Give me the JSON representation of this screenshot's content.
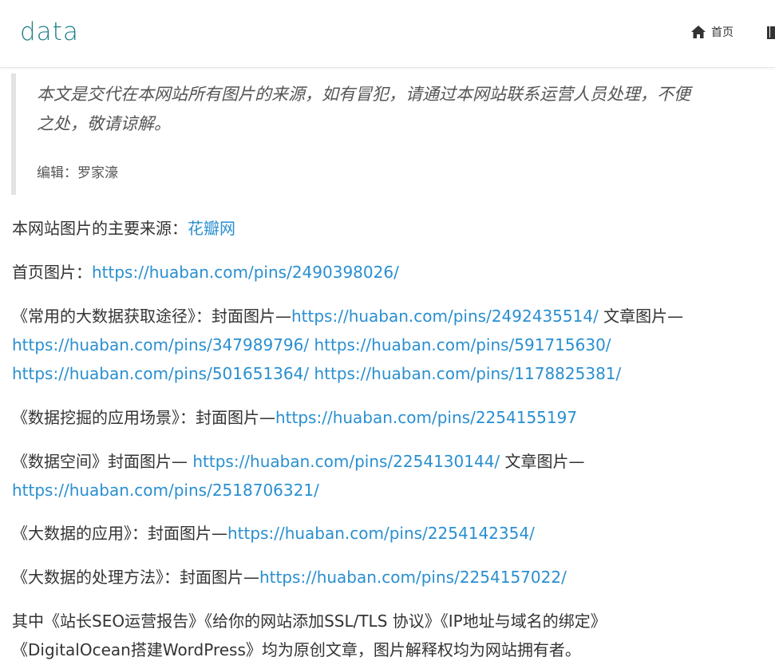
{
  "header": {
    "logo": "data",
    "nav_home_label": "首页"
  },
  "quote": {
    "line1": "本文是交代在本网站所有图片的来源，如有冒犯，请通过本网站联系运营人员处理，不便",
    "line2": "之处，敬请谅解。",
    "editor": "编辑：罗家濠"
  },
  "content": {
    "source_prefix": "本网站图片的主要来源：",
    "source_link": "花瓣网",
    "home_prefix": "首页图片：",
    "home_link": "https://huaban.com/pins/2490398026/",
    "p1_prefix": "《常用的大数据获取途径》：封面图片—",
    "p1_cover_link": "https://huaban.com/pins/2492435514/",
    "p1_mid": " 文章图片—",
    "p1_link1": "https://huaban.com/pins/347989796/",
    "p1_link2": "https://huaban.com/pins/591715630/",
    "p1_link3": "https://huaban.com/pins/501651364/",
    "p1_link4": "https://huaban.com/pins/1178825381/",
    "p2_prefix": "《数据挖掘的应用场景》：封面图片—",
    "p2_link": "https://huaban.com/pins/2254155197",
    "p3_prefix": "《数据空间》封面图片— ",
    "p3_cover_link": "https://huaban.com/pins/2254130144/",
    "p3_mid": " 文章图片—",
    "p3_link": "https://huaban.com/pins/2518706321/",
    "p4_prefix": "《大数据的应用》：封面图片—",
    "p4_link": "https://huaban.com/pins/2254142354/",
    "p5_prefix": "《大数据的处理方法》：封面图片—",
    "p5_link": "https://huaban.com/pins/2254157022/",
    "p6_line1": "其中《站长SEO运营报告》《给你的网站添加SSL/TLS 协议》《IP地址与域名的绑定》",
    "p6_line2": "《DigitalOcean搭建WordPress》均为原创文章，图片解释权均为网站拥有者。"
  },
  "colors": {
    "logo": "#1e7f86",
    "link": "#2a8fd0",
    "text": "#333333",
    "quote_border": "#e3e3e3"
  },
  "icons": [
    "home-icon",
    "book-icon"
  ]
}
